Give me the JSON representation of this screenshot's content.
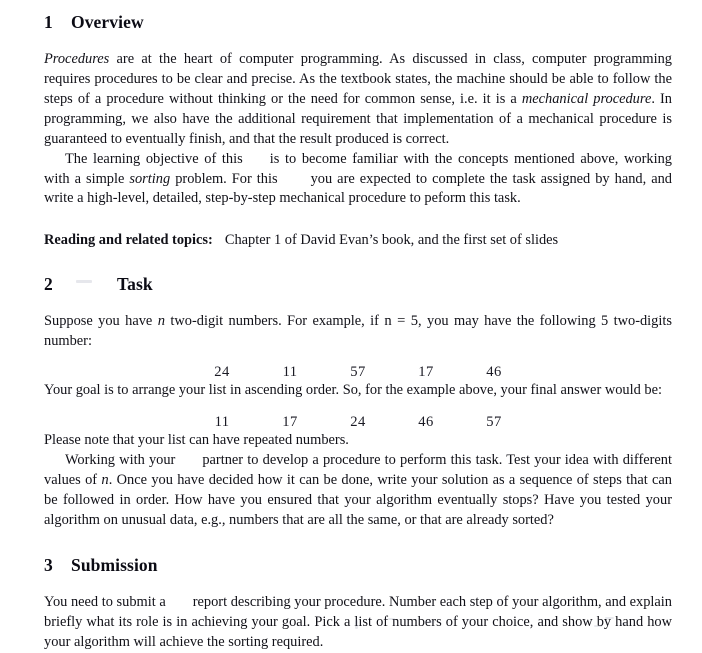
{
  "document": {
    "kind": "assignment-handout",
    "background_color": "#ffffff",
    "text_color": "#111118"
  },
  "sections": [
    {
      "number": "1",
      "title": "Overview",
      "redacted_in_title": false
    },
    {
      "number": "2",
      "title": "Task",
      "redacted_in_title": true,
      "redacted_title_placeholder": ""
    },
    {
      "number": "3",
      "title": "Submission",
      "redacted_in_title": false
    }
  ],
  "overview": {
    "paragraph1": {
      "lead_italic": "Procedures",
      "part1": " are at the heart of computer programming. As discussed in class, computer programming requires procedures to be clear and precise. As the textbook states, the machine should be able to follow the steps of a procedure without thinking or the need for common sense, i.e. it is a ",
      "italic2": "mechanical procedure",
      "part2": ". In programming, we also have the additional requirement that implementation of a mechanical procedure is guaranteed to eventually finish, and that the result produced is correct."
    },
    "paragraph2": {
      "part1": "The learning objective of this",
      "redacted1": "",
      "part2": "is to become familiar with the concepts mentioned above, working with a simple ",
      "italic1": "sorting",
      "part3": " problem. For this",
      "redacted2": "",
      "part4": "you are expected to complete the task assigned by hand, and write a high-level, detailed, step-by-step mechanical procedure to peform this task."
    }
  },
  "reading": {
    "label": "Reading and related topics:",
    "value": "Chapter 1 of David Evan’s book, and the first set of slides"
  },
  "task": {
    "paragraph1": {
      "part1": "Suppose you have ",
      "var1": "n",
      "part2": " two-digit numbers. For example, if ",
      "equation": "n = 5",
      "part3": ", you may have the following 5 two-digits number:"
    },
    "example_numbers": [
      "24",
      "11",
      "57",
      "17",
      "46"
    ],
    "paragraph2": "Your goal is to arrange your list in ascending order. So, for the example above, your final answer would be:",
    "sorted_numbers": [
      "11",
      "17",
      "24",
      "46",
      "57"
    ],
    "paragraph3": "Please note that your list can have repeated numbers.",
    "paragraph4": {
      "part1": "Working with your",
      "redacted1": "",
      "part2": "partner to develop a procedure to perform this task. Test your idea with different values of ",
      "var1": "n",
      "part3": ". Once you have decided how it can be done, write your solution as a sequence of steps that can be followed in order. How have you ensured that your algorithm eventually stops? Have you tested your algorithm on unusual data, e.g., numbers that are all the same, or that are already sorted?"
    }
  },
  "submission": {
    "paragraph1": {
      "part1": "You need to submit a",
      "redacted1": "",
      "part2": "report describing your procedure. Number each step of your algorithm, and explain briefly what its role is in achieving your goal. Pick a list of numbers of your choice, and show by hand how your algorithm will achieve the sorting required."
    }
  },
  "math_symbols": {
    "variable_n": "n",
    "equation_n_equals_5": "n = 5"
  }
}
